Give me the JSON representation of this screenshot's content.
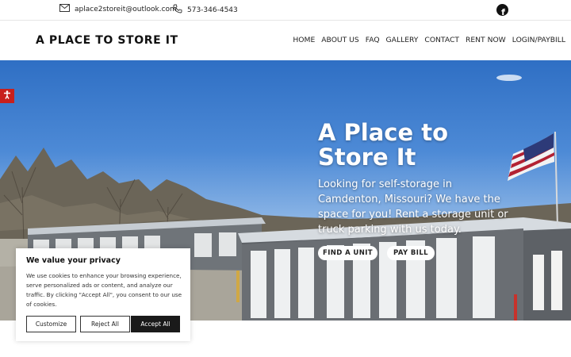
{
  "topbar": {
    "email": "aplace2storeit@outlook.com",
    "phone": "573-346-4543",
    "social_icon": "facebook-icon"
  },
  "header": {
    "logo": "A PLACE TO STORE IT",
    "nav": [
      "HOME",
      "ABOUT US",
      "FAQ",
      "GALLERY",
      "CONTACT",
      "RENT NOW",
      "LOGIN/PAYBILL"
    ]
  },
  "hero": {
    "title": "A Place to Store It",
    "subtitle": "Looking for self-storage in Camdenton, Missouri? We have the space for you! Rent a storage unit or truck parking with us today.",
    "buttons": [
      "FIND A UNIT",
      "PAY BILL"
    ]
  },
  "accessibility": {
    "icon": "accessibility-icon"
  },
  "cookie": {
    "title": "We value your privacy",
    "text": "We use cookies to enhance your browsing experience, serve personalized ads or content, and analyze our traffic. By clicking \"Accept All\", you consent to our use of cookies.",
    "buttons": [
      "Customize",
      "Reject All",
      "Accept All"
    ]
  },
  "colors": {
    "accessibility": "#c8201d",
    "accept_button": "#1a1a1a"
  }
}
